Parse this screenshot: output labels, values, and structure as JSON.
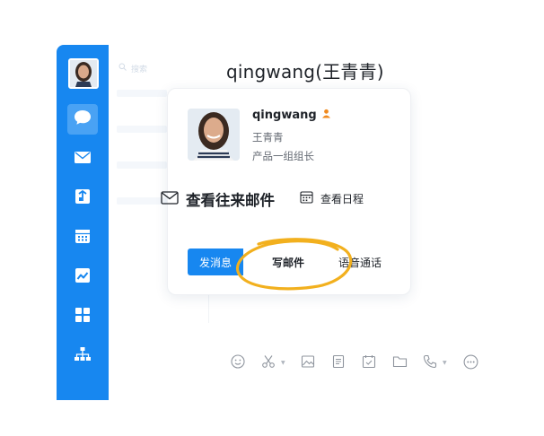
{
  "colors": {
    "sidebar": "#1787f0",
    "primary": "#1787f0",
    "highlight": "#f2b01e",
    "role_badge": "#f08a1f"
  },
  "sidebar": {
    "items": [
      {
        "icon": "chat-icon",
        "active": true
      },
      {
        "icon": "mail-icon"
      },
      {
        "icon": "tasks-icon"
      },
      {
        "icon": "calendar-icon"
      },
      {
        "icon": "docs-icon"
      },
      {
        "icon": "apps-grid-icon"
      },
      {
        "icon": "org-chart-icon"
      }
    ]
  },
  "search": {
    "placeholder": "搜索"
  },
  "chat": {
    "title": "qingwang(王青青)"
  },
  "profile": {
    "username": "qingwang",
    "chinese_name": "王青青",
    "department": "产品一组组长",
    "role_icon": "person-badge-icon"
  },
  "actions": {
    "view_mail": "查看往来邮件",
    "view_schedule": "查看日程"
  },
  "buttons": {
    "send_message": "发消息",
    "write_mail": "写邮件",
    "voice_call": "语音通话"
  },
  "toolbar": {
    "icons": [
      "emoji-icon",
      "scissors-icon",
      "image-icon",
      "document-icon",
      "task-check-icon",
      "folder-icon",
      "phone-icon",
      "more-icon"
    ]
  }
}
